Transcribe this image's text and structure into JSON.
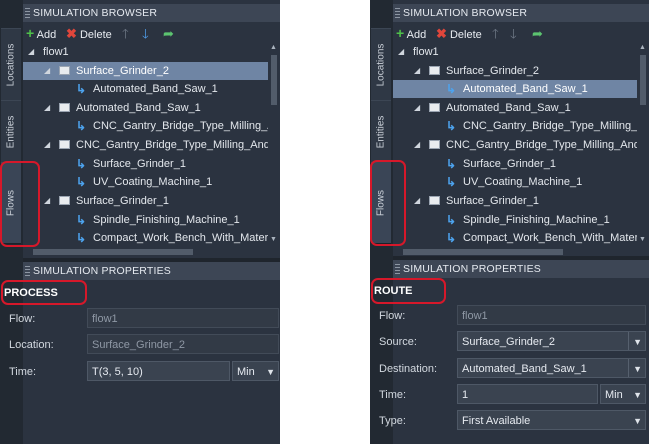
{
  "left": {
    "tabs": [
      "Locations",
      "Entities",
      "Flows"
    ],
    "browser_header": "SIMULATION BROWSER",
    "toolbar": {
      "add": "Add",
      "delete": "Delete"
    },
    "tree": [
      {
        "label": "flow1"
      },
      {
        "label": "Surface_Grinder_2"
      },
      {
        "label": "Automated_Band_Saw_1"
      },
      {
        "label": "Automated_Band_Saw_1"
      },
      {
        "label": "CNC_Gantry_Bridge_Type_Milling_And_"
      },
      {
        "label": "CNC_Gantry_Bridge_Type_Milling_And_Drill"
      },
      {
        "label": "Surface_Grinder_1"
      },
      {
        "label": "UV_Coating_Machine_1"
      },
      {
        "label": "Surface_Grinder_1"
      },
      {
        "label": "Spindle_Finishing_Machine_1"
      },
      {
        "label": "Compact_Work_Bench_With_Material_H"
      }
    ],
    "props_header": "SIMULATION PROPERTIES",
    "props_title": "PROCESS",
    "fields": {
      "flow_label": "Flow:",
      "flow_value": "flow1",
      "location_label": "Location:",
      "location_value": "Surface_Grinder_2",
      "time_label": "Time:",
      "time_value": "T(3, 5, 10)",
      "time_unit": "Min"
    }
  },
  "right": {
    "tabs": [
      "Locations",
      "Entities",
      "Flows"
    ],
    "browser_header": "SIMULATION BROWSER",
    "toolbar": {
      "add": "Add",
      "delete": "Delete"
    },
    "tree": [
      {
        "label": "flow1"
      },
      {
        "label": "Surface_Grinder_2"
      },
      {
        "label": "Automated_Band_Saw_1"
      },
      {
        "label": "Automated_Band_Saw_1"
      },
      {
        "label": "CNC_Gantry_Bridge_Type_Milling_And_"
      },
      {
        "label": "CNC_Gantry_Bridge_Type_Milling_And_Drill"
      },
      {
        "label": "Surface_Grinder_1"
      },
      {
        "label": "UV_Coating_Machine_1"
      },
      {
        "label": "Surface_Grinder_1"
      },
      {
        "label": "Spindle_Finishing_Machine_1"
      },
      {
        "label": "Compact_Work_Bench_With_Material_H"
      }
    ],
    "props_header": "SIMULATION PROPERTIES",
    "props_title": "ROUTE",
    "fields": {
      "flow_label": "Flow:",
      "flow_value": "flow1",
      "source_label": "Source:",
      "source_value": "Surface_Grinder_2",
      "destination_label": "Destination:",
      "destination_value": "Automated_Band_Saw_1",
      "time_label": "Time:",
      "time_value": "1",
      "time_unit": "Min",
      "type_label": "Type:",
      "type_value": "First Available"
    }
  },
  "colors": {
    "highlight": "#d6182a",
    "selected_row": "#6f85a4",
    "panel_bg": "#2b3340"
  }
}
